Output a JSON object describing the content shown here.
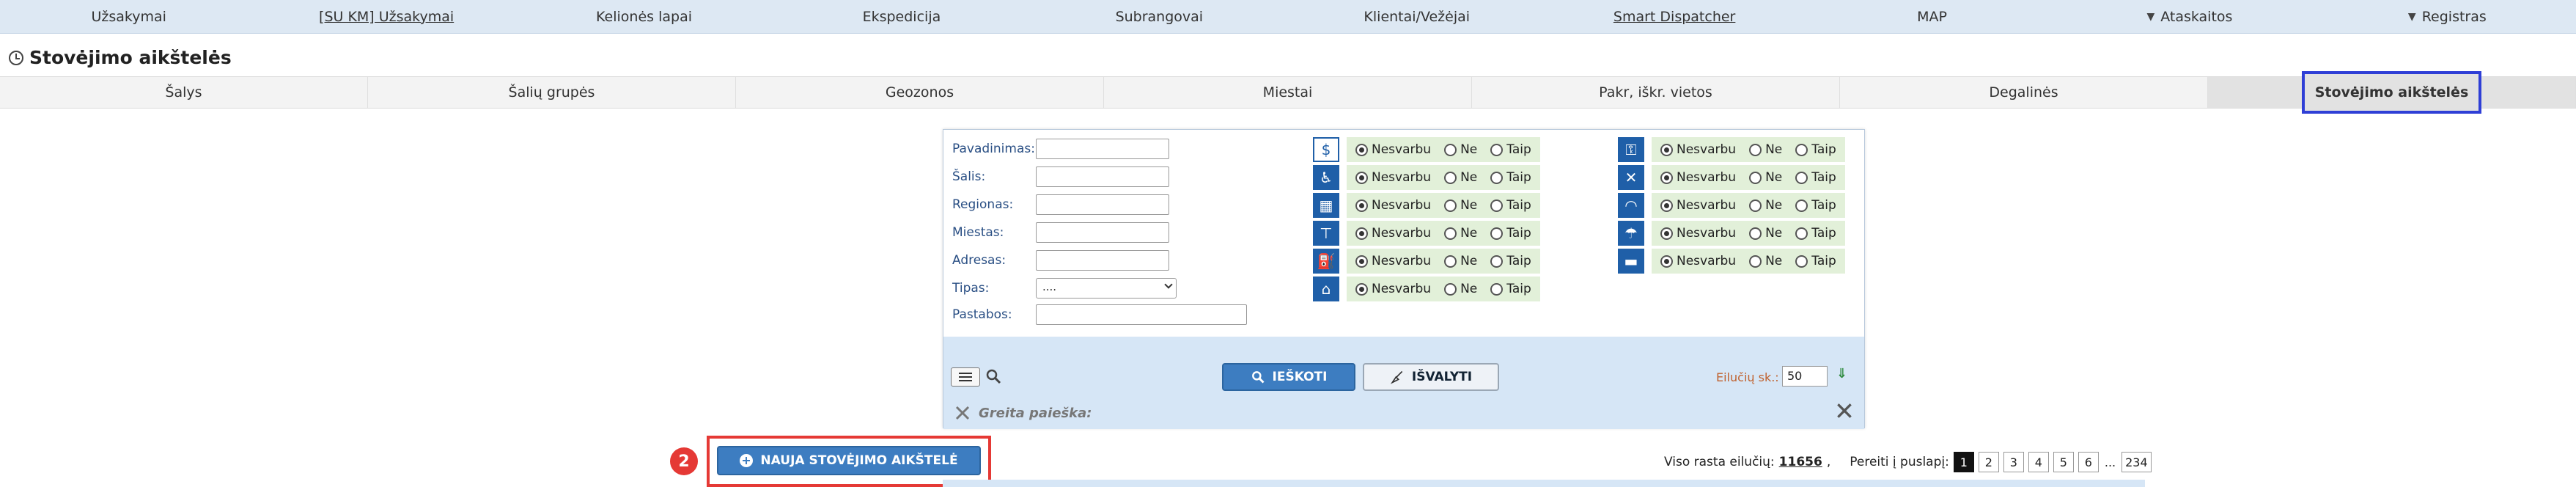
{
  "topnav": [
    {
      "label": "Užsakymai",
      "underline": false,
      "dropdown": false
    },
    {
      "label": "[SU KM] Užsakymai",
      "underline": true,
      "dropdown": false
    },
    {
      "label": "Kelionės lapai",
      "underline": false,
      "dropdown": false
    },
    {
      "label": "Ekspedicija",
      "underline": false,
      "dropdown": false
    },
    {
      "label": "Subrangovai",
      "underline": false,
      "dropdown": false
    },
    {
      "label": "Klientai/Vežėjai",
      "underline": false,
      "dropdown": false
    },
    {
      "label": "Smart Dispatcher",
      "underline": true,
      "dropdown": false
    },
    {
      "label": "MAP",
      "underline": false,
      "dropdown": false
    },
    {
      "label": "Ataskaitos",
      "underline": false,
      "dropdown": true
    },
    {
      "label": "Registras",
      "underline": false,
      "dropdown": true
    }
  ],
  "page_title": "Stovėjimo aikštelės",
  "subtabs": [
    "Šalys",
    "Šalių grupės",
    "Geozonos",
    "Miestai",
    "Pakr, iškr. vietos",
    "Degalinės",
    "Stovėjimo aikštelės"
  ],
  "active_subtab": "Stovėjimo aikštelės",
  "filters": {
    "pavadinimas_label": "Pavadinimas:",
    "salis_label": "Šalis:",
    "regionas_label": "Regionas:",
    "miestas_label": "Miestas:",
    "adresas_label": "Adresas:",
    "tipas_label": "Tipas:",
    "tipas_value": "....",
    "pastabos_label": "Pastabos:"
  },
  "facility_options": {
    "any": "Nesvarbu",
    "no": "Ne",
    "yes": "Taip"
  },
  "facilities_left": [
    "money-icon",
    "restroom-icon",
    "fence-icon",
    "lighting-icon",
    "fuel-icon",
    "house-icon"
  ],
  "facilities_right": [
    "security-icon",
    "repair-icon",
    "wifi-icon",
    "shower-icon",
    "bed-icon"
  ],
  "buttons": {
    "search": "IEŠKOTI",
    "clear": "IŠVALYTI",
    "new": "NAUJA STOVĖJIMO AIKŠTELĖ"
  },
  "rows_per_page": {
    "label": "Eilučių sk.:",
    "value": "50"
  },
  "quick_search_label": "Greita paieška:",
  "badge": "2",
  "pager": {
    "total_label": "Viso rasta eilučių:",
    "total": "11656",
    "comma": ",",
    "goto_label": "Pereiti į puslapį:",
    "pages": [
      "1",
      "2",
      "3",
      "4",
      "5",
      "6"
    ],
    "ellipsis": "...",
    "last": "234",
    "current": "1"
  },
  "colors": {
    "accent": "#3d7dc1",
    "active_tab_border": "#2f3fd6",
    "highlight": "#e53935",
    "facility_bg": "#e2f0d9"
  }
}
